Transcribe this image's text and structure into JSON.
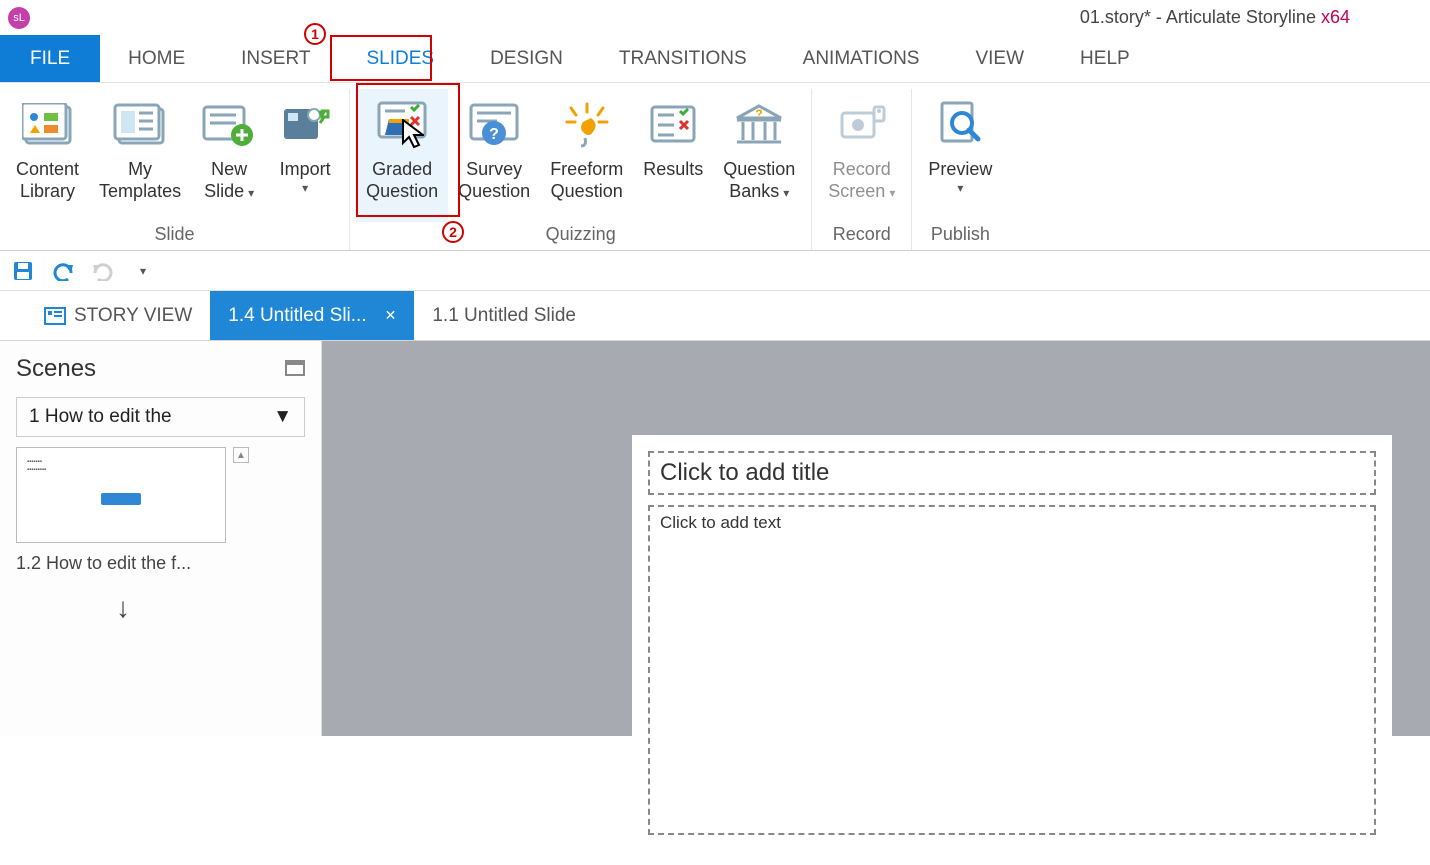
{
  "title": {
    "file": "01.story*",
    "sep": " - ",
    "app": "Articulate Storyline",
    "arch": "  x64",
    "badge": "sL"
  },
  "menu": {
    "file": "FILE",
    "home": "HOME",
    "insert": "INSERT",
    "slides": "SLIDES",
    "design": "DESIGN",
    "transitions": "TRANSITIONS",
    "animations": "ANIMATIONS",
    "view": "VIEW",
    "help": "HELP"
  },
  "callouts": {
    "one": "1",
    "two": "2"
  },
  "ribbon": {
    "groups": {
      "slide": "Slide",
      "quizzing": "Quizzing",
      "record": "Record",
      "publish": "Publish"
    },
    "buttons": {
      "content_library": "Content\nLibrary",
      "my_templates": "My\nTemplates",
      "new_slide": "New\nSlide",
      "import": "Import",
      "graded_question": "Graded\nQuestion",
      "survey_question": "Survey\nQuestion",
      "freeform_question": "Freeform\nQuestion",
      "results": "Results",
      "question_banks": "Question\nBanks",
      "record_screen": "Record\nScreen",
      "preview": "Preview"
    }
  },
  "doc_tabs": {
    "story_view": "STORY VIEW",
    "t1": "1.4 Untitled Sli...",
    "t2": "1.1 Untitled Slide"
  },
  "scenes": {
    "heading": "Scenes",
    "selector": "1 How to edit the",
    "thumb_caption": "1.2 How to edit the f..."
  },
  "canvas": {
    "title_ph": "Click to add title",
    "body_ph": "Click to add text"
  }
}
